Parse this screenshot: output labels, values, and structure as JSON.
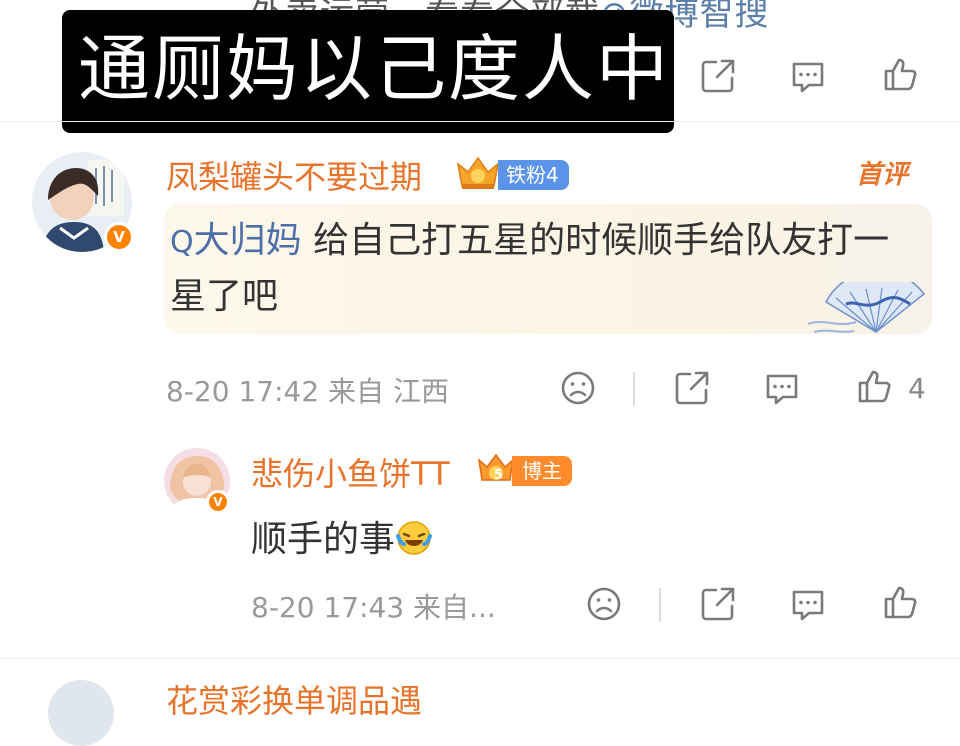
{
  "prev_post": {
    "top_line_text": "外卖运营，看看全部截",
    "link_text": "微博智搜"
  },
  "overlay": {
    "title": "通厕妈以己度人中"
  },
  "comment": {
    "username": "凤梨罐头不要过期",
    "fan_badge": "铁粉4",
    "first_tag": "首评",
    "mention": "大归妈",
    "text": "给自己打五星的时候顺手给队友打一星了吧",
    "date": "8-20 17:42",
    "source": "来自 江西",
    "like_count": "4"
  },
  "reply": {
    "username": "悲伤小鱼饼TT",
    "badge": "博主",
    "badge_level": "5",
    "text": "顺手的事",
    "emoji": "laughing-crying-emoji",
    "date": "8-20 17:43",
    "source": "来自..."
  },
  "next_comment": {
    "partial_name": "花赏彩换单调品遇"
  },
  "colors": {
    "username": "#e8742c",
    "mention": "#4e6ea8",
    "fan_badge": "#5a93e8",
    "blogger_badge": "#ff8b2d",
    "icon_gray": "#7a7a7a"
  }
}
